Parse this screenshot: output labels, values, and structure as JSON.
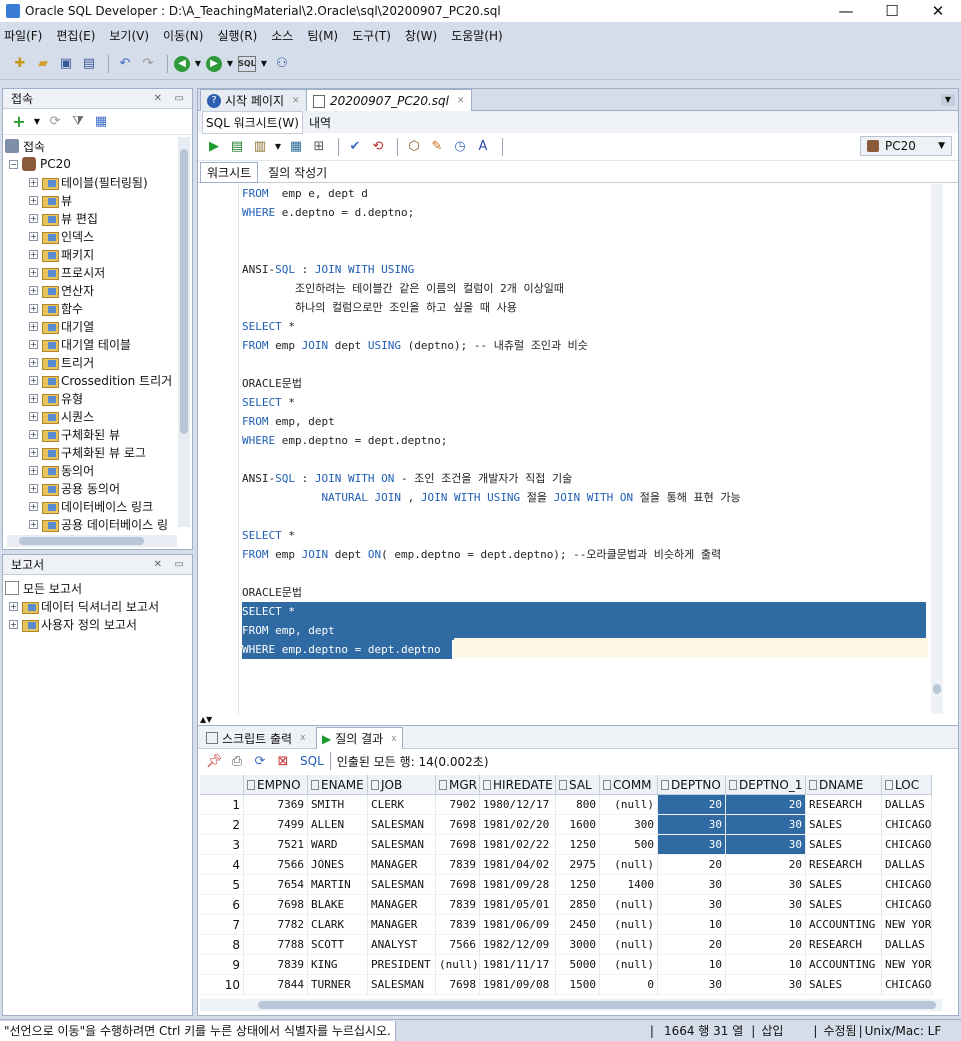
{
  "window": {
    "title": "Oracle SQL Developer : D:\\A_TeachingMaterial\\2.Oracle\\sql\\20200907_PC20.sql",
    "min": "—",
    "max": "☐",
    "close": "✕"
  },
  "menu": [
    "파일(F)",
    "편집(E)",
    "보기(V)",
    "이동(N)",
    "실행(R)",
    "소스",
    "팀(M)",
    "도구(T)",
    "창(W)",
    "도움말(H)"
  ],
  "connections": {
    "title": "접속",
    "root_label": "접속",
    "db": "PC20",
    "items": [
      "테이블(필터링됨)",
      "뷰",
      "뷰 편집",
      "인덱스",
      "패키지",
      "프로시저",
      "연산자",
      "함수",
      "대기열",
      "대기열 테이블",
      "트리거",
      "Crossedition 트리거",
      "유형",
      "시퀀스",
      "구체화된 뷰",
      "구체화된 뷰 로그",
      "동의어",
      "공용 동의어",
      "데이터베이스 링크",
      "공용 데이터베이스 링"
    ]
  },
  "reports": {
    "title": "보고서",
    "root": "모든 보고서",
    "items": [
      "데이터 딕셔너리 보고서",
      "사용자 정의 보고서"
    ]
  },
  "editor": {
    "tabs": [
      "시작 페이지",
      "20200907_PC20.sql"
    ],
    "subtabs": [
      "SQL 워크시트(W)",
      "내역"
    ],
    "connection": "PC20",
    "inner_tabs": [
      "워크시트",
      "질의 작성기"
    ]
  },
  "code": [
    {
      "segments": [
        [
          "kw",
          "FROM"
        ],
        [
          "",
          "  emp e, dept d"
        ]
      ]
    },
    {
      "segments": [
        [
          "kw",
          "WHERE"
        ],
        [
          "",
          " e.deptno = d.deptno;"
        ]
      ]
    },
    {
      "segments": []
    },
    {
      "segments": []
    },
    {
      "segments": [
        [
          "",
          "ANSI-"
        ],
        [
          "kw",
          "SQL"
        ],
        [
          "",
          " : "
        ],
        [
          "kw",
          "JOIN WITH USING"
        ]
      ]
    },
    {
      "segments": [
        [
          "",
          "        조인하려는 테이블간 같은 이름의 컬럼이 2개 이상일때"
        ]
      ]
    },
    {
      "segments": [
        [
          "",
          "        하나의 컬럼으로만 조인을 하고 싶을 때 사용"
        ]
      ]
    },
    {
      "segments": [
        [
          "kw",
          "SELECT"
        ],
        [
          "",
          " *"
        ]
      ]
    },
    {
      "segments": [
        [
          "kw",
          "FROM"
        ],
        [
          "",
          " emp "
        ],
        [
          "kw",
          "JOIN"
        ],
        [
          "",
          " dept "
        ],
        [
          "kw",
          "USING"
        ],
        [
          "",
          " (deptno); -- 내츄럴 조인과 비슷"
        ]
      ]
    },
    {
      "segments": []
    },
    {
      "segments": [
        [
          "",
          "ORACLE문법"
        ]
      ]
    },
    {
      "segments": [
        [
          "kw",
          "SELECT"
        ],
        [
          "",
          " *"
        ]
      ]
    },
    {
      "segments": [
        [
          "kw",
          "FROM"
        ],
        [
          "",
          " emp, dept"
        ]
      ]
    },
    {
      "segments": [
        [
          "kw",
          "WHERE"
        ],
        [
          "",
          " emp.deptno = dept.deptno;"
        ]
      ]
    },
    {
      "segments": []
    },
    {
      "segments": [
        [
          "",
          "ANSI-"
        ],
        [
          "kw",
          "SQL"
        ],
        [
          "",
          " : "
        ],
        [
          "kw",
          "JOIN WITH ON"
        ],
        [
          "",
          " - 조인 조건을 개발자가 직접 기술"
        ]
      ]
    },
    {
      "segments": [
        [
          "",
          "            "
        ],
        [
          "kw",
          "NATURAL JOIN"
        ],
        [
          "",
          " , "
        ],
        [
          "kw",
          "JOIN WITH USING"
        ],
        [
          "",
          " 절을 "
        ],
        [
          "kw",
          "JOIN WITH ON"
        ],
        [
          "",
          " 절을 통해 표현 가능"
        ]
      ]
    },
    {
      "segments": []
    },
    {
      "segments": [
        [
          "kw",
          "SELECT"
        ],
        [
          "",
          " *"
        ]
      ]
    },
    {
      "segments": [
        [
          "kw",
          "FROM"
        ],
        [
          "",
          " emp "
        ],
        [
          "kw",
          "JOIN"
        ],
        [
          "",
          " dept "
        ],
        [
          "kw",
          "ON"
        ],
        [
          "",
          "( emp.deptno = dept.deptno); --오라클문법과 비슷하게 출력"
        ]
      ]
    },
    {
      "segments": []
    },
    {
      "segments": [
        [
          "",
          "ORACLE문법"
        ]
      ]
    },
    {
      "segments": [
        [
          "sel",
          "SELECT *"
        ]
      ]
    },
    {
      "segments": [
        [
          "sel",
          "FROM emp, dept"
        ]
      ]
    },
    {
      "segments": [
        [
          "sel",
          "WHERE emp.deptno = dept.deptno"
        ]
      ]
    }
  ],
  "results": {
    "tabs": [
      "스크립트 출력",
      "질의 결과"
    ],
    "sql_label": "SQL",
    "fetched": "인출된 모든 행: 14(0.002초)",
    "columns": [
      "EMPNO",
      "ENAME",
      "JOB",
      "MGR",
      "HIREDATE",
      "SAL",
      "COMM",
      "DEPTNO",
      "DEPTNO_1",
      "DNAME",
      "LOC"
    ],
    "rows": [
      [
        "1",
        "7369",
        "SMITH",
        "CLERK",
        "7902",
        "1980/12/17",
        "800",
        "(null)",
        "20",
        "20",
        "RESEARCH",
        "DALLAS"
      ],
      [
        "2",
        "7499",
        "ALLEN",
        "SALESMAN",
        "7698",
        "1981/02/20",
        "1600",
        "300",
        "30",
        "30",
        "SALES",
        "CHICAGO"
      ],
      [
        "3",
        "7521",
        "WARD",
        "SALESMAN",
        "7698",
        "1981/02/22",
        "1250",
        "500",
        "30",
        "30",
        "SALES",
        "CHICAGO"
      ],
      [
        "4",
        "7566",
        "JONES",
        "MANAGER",
        "7839",
        "1981/04/02",
        "2975",
        "(null)",
        "20",
        "20",
        "RESEARCH",
        "DALLAS"
      ],
      [
        "5",
        "7654",
        "MARTIN",
        "SALESMAN",
        "7698",
        "1981/09/28",
        "1250",
        "1400",
        "30",
        "30",
        "SALES",
        "CHICAGO"
      ],
      [
        "6",
        "7698",
        "BLAKE",
        "MANAGER",
        "7839",
        "1981/05/01",
        "2850",
        "(null)",
        "30",
        "30",
        "SALES",
        "CHICAGO"
      ],
      [
        "7",
        "7782",
        "CLARK",
        "MANAGER",
        "7839",
        "1981/06/09",
        "2450",
        "(null)",
        "10",
        "10",
        "ACCOUNTING",
        "NEW YOR"
      ],
      [
        "8",
        "7788",
        "SCOTT",
        "ANALYST",
        "7566",
        "1982/12/09",
        "3000",
        "(null)",
        "20",
        "20",
        "RESEARCH",
        "DALLAS"
      ],
      [
        "9",
        "7839",
        "KING",
        "PRESIDENT",
        "(null)",
        "1981/11/17",
        "5000",
        "(null)",
        "10",
        "10",
        "ACCOUNTING",
        "NEW YOR"
      ],
      [
        "10",
        "7844",
        "TURNER",
        "SALESMAN",
        "7698",
        "1981/09/08",
        "1500",
        "0",
        "30",
        "30",
        "SALES",
        "CHICAGO"
      ]
    ]
  },
  "status": {
    "hint": "\"선언으로 이동\"을 수행하려면 Ctrl 키를 누른 상태에서 식별자를 누르십시오.",
    "position": "1664 행 31 열",
    "mode": "삽입",
    "modified": "수정됨",
    "eol": "Unix/Mac: LF"
  }
}
